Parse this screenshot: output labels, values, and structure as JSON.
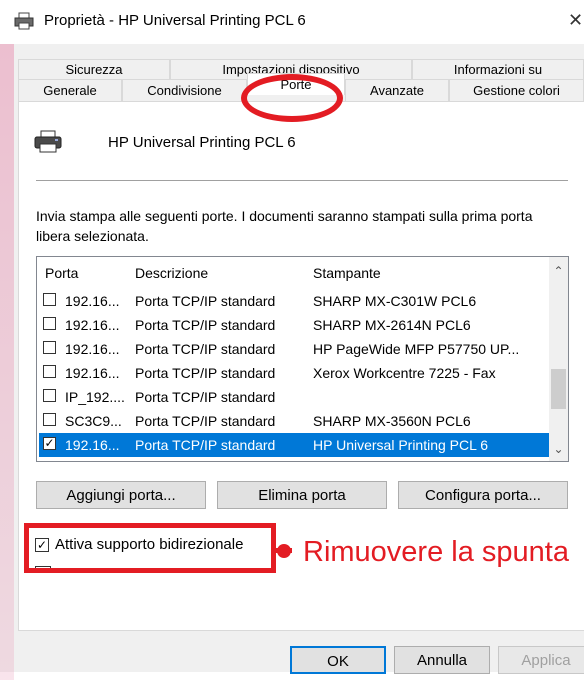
{
  "window": {
    "title": "Proprietà - HP Universal Printing PCL 6",
    "close_glyph": "✕"
  },
  "tabs_back": [
    "Sicurezza",
    "Impostazioni dispositivo",
    "Informazioni su"
  ],
  "tabs_front": [
    "Generale",
    "Condivisione",
    "Porte",
    "Avanzate",
    "Gestione colori"
  ],
  "active_tab": "Porte",
  "printer": {
    "name": "HP Universal Printing PCL 6",
    "icon": "printer-icon"
  },
  "description": "Invia stampa alle seguenti porte. I documenti saranno stampati sulla prima porta libera selezionata.",
  "port_list": {
    "columns": [
      "Porta",
      "Descrizione",
      "Stampante"
    ],
    "rows": [
      {
        "checked": false,
        "port": "192.16...",
        "desc": "Porta TCP/IP standard",
        "printer": "SHARP MX-C301W PCL6"
      },
      {
        "checked": false,
        "port": "192.16...",
        "desc": "Porta TCP/IP standard",
        "printer": "SHARP MX-2614N PCL6"
      },
      {
        "checked": false,
        "port": "192.16...",
        "desc": "Porta TCP/IP standard",
        "printer": "HP PageWide MFP P57750 UP..."
      },
      {
        "checked": false,
        "port": "192.16...",
        "desc": "Porta TCP/IP standard",
        "printer": "Xerox Workcentre 7225 - Fax"
      },
      {
        "checked": false,
        "port": "IP_192....",
        "desc": "Porta TCP/IP standard",
        "printer": ""
      },
      {
        "checked": false,
        "port": "SC3C9...",
        "desc": "Porta TCP/IP standard",
        "printer": "SHARP MX-3560N PCL6"
      },
      {
        "checked": true,
        "port": "192.16...",
        "desc": "Porta TCP/IP standard",
        "printer": "HP Universal Printing PCL 6",
        "selected": true
      }
    ]
  },
  "buttons": {
    "add_port": "Aggiungi porta...",
    "delete_port": "Elimina porta",
    "configure_port": "Configura porta..."
  },
  "bidirectional": {
    "label": "Attiva supporto bidirezionale",
    "checked": true
  },
  "annotation": {
    "text": "Rimuovere la spunta",
    "color": "#e31c23"
  },
  "footer": {
    "ok": "OK",
    "cancel": "Annulla",
    "apply": "Applica"
  },
  "colors": {
    "selection": "#0078d7",
    "annotation_red": "#e31c23"
  }
}
